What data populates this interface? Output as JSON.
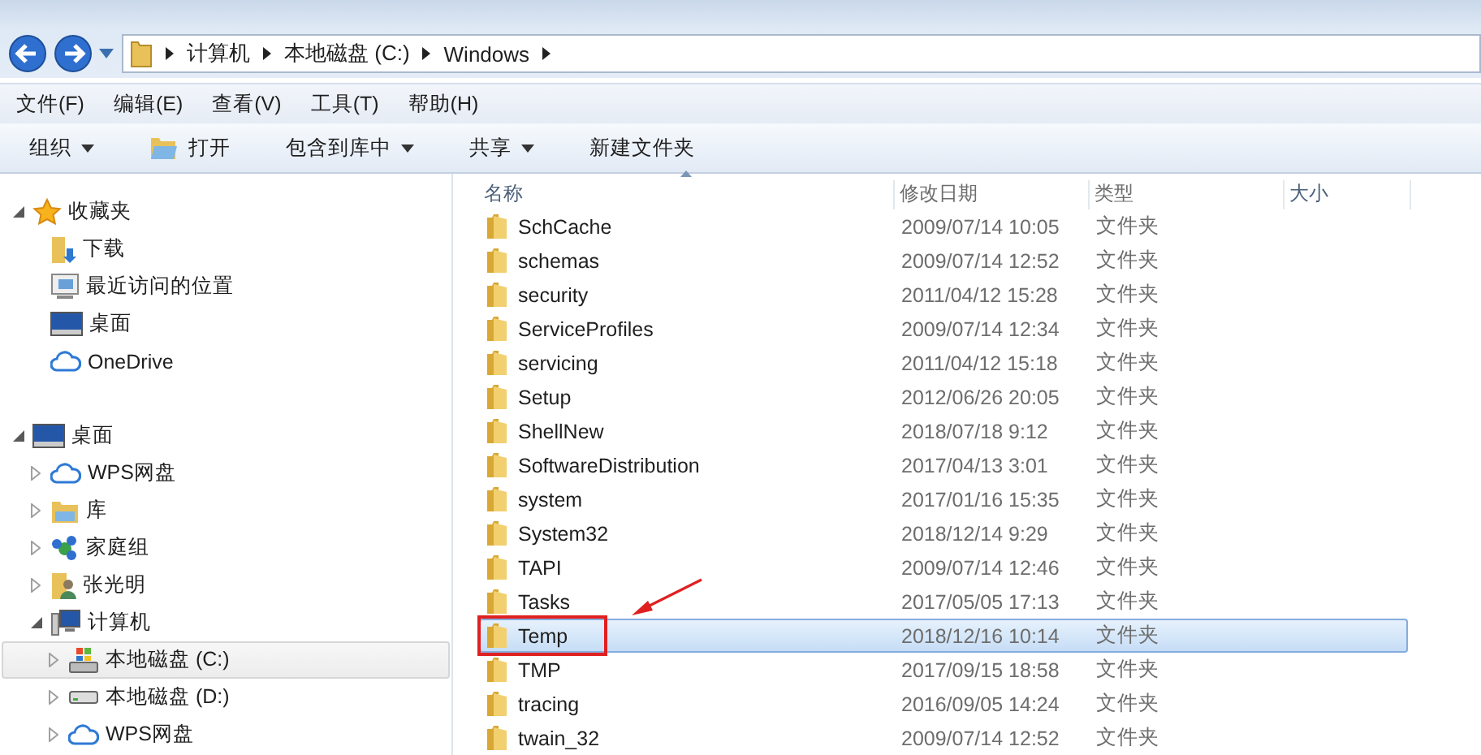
{
  "address_bar": {
    "crumbs": [
      "计算机",
      "本地磁盘 (C:)",
      "Windows"
    ]
  },
  "menu_bar": [
    "文件(F)",
    "编辑(E)",
    "查看(V)",
    "工具(T)",
    "帮助(H)"
  ],
  "toolbar": [
    {
      "label": "组织",
      "dropdown": true
    },
    {
      "label": "打开",
      "dropdown": false
    },
    {
      "label": "包含到库中",
      "dropdown": true
    },
    {
      "label": "共享",
      "dropdown": true
    },
    {
      "label": "新建文件夹",
      "dropdown": false
    }
  ],
  "nav_tree": [
    {
      "label": "收藏夹",
      "expanded": true,
      "selected": false,
      "children": [
        {
          "label": "下载",
          "selected": false
        },
        {
          "label": "最近访问的位置",
          "selected": false
        },
        {
          "label": "桌面",
          "selected": false
        },
        {
          "label": "OneDrive",
          "selected": false
        }
      ]
    },
    {
      "label": "桌面",
      "expanded": true,
      "selected": false,
      "children": [
        {
          "label": "WPS网盘",
          "expanded": false,
          "selected": false
        },
        {
          "label": "库",
          "expanded": false,
          "selected": false
        },
        {
          "label": "家庭组",
          "expanded": false,
          "selected": false
        },
        {
          "label": "张光明",
          "expanded": false,
          "selected": false
        },
        {
          "label": "计算机",
          "expanded": true,
          "selected": false,
          "children": [
            {
              "label": "本地磁盘 (C:)",
              "expanded": false,
              "selected": true
            },
            {
              "label": "本地磁盘 (D:)",
              "expanded": false,
              "selected": false
            },
            {
              "label": "WPS网盘",
              "expanded": false,
              "selected": false
            }
          ]
        }
      ]
    }
  ],
  "file_list": {
    "columns": [
      {
        "label": "名称",
        "sorted": true
      },
      {
        "label": "修改日期",
        "sorted": false
      },
      {
        "label": "类型",
        "sorted": false
      },
      {
        "label": "大小",
        "sorted": false
      }
    ],
    "rows": [
      {
        "name": "SchCache",
        "modified": "2009/07/14 10:05",
        "type": "文件夹",
        "selected": false,
        "callout": false
      },
      {
        "name": "schemas",
        "modified": "2009/07/14 12:52",
        "type": "文件夹",
        "selected": false,
        "callout": false
      },
      {
        "name": "security",
        "modified": "2011/04/12 15:28",
        "type": "文件夹",
        "selected": false,
        "callout": false
      },
      {
        "name": "ServiceProfiles",
        "modified": "2009/07/14 12:34",
        "type": "文件夹",
        "selected": false,
        "callout": false
      },
      {
        "name": "servicing",
        "modified": "2011/04/12 15:18",
        "type": "文件夹",
        "selected": false,
        "callout": false
      },
      {
        "name": "Setup",
        "modified": "2012/06/26 20:05",
        "type": "文件夹",
        "selected": false,
        "callout": false
      },
      {
        "name": "ShellNew",
        "modified": "2018/07/18 9:12",
        "type": "文件夹",
        "selected": false,
        "callout": false
      },
      {
        "name": "SoftwareDistribution",
        "modified": "2017/04/13 3:01",
        "type": "文件夹",
        "selected": false,
        "callout": false
      },
      {
        "name": "system",
        "modified": "2017/01/16 15:35",
        "type": "文件夹",
        "selected": false,
        "callout": false
      },
      {
        "name": "System32",
        "modified": "2018/12/14 9:29",
        "type": "文件夹",
        "selected": false,
        "callout": false
      },
      {
        "name": "TAPI",
        "modified": "2009/07/14 12:46",
        "type": "文件夹",
        "selected": false,
        "callout": false
      },
      {
        "name": "Tasks",
        "modified": "2017/05/05 17:13",
        "type": "文件夹",
        "selected": false,
        "callout": false
      },
      {
        "name": "Temp",
        "modified": "2018/12/16 10:14",
        "type": "文件夹",
        "selected": true,
        "callout": true
      },
      {
        "name": "TMP",
        "modified": "2017/09/15 18:58",
        "type": "文件夹",
        "selected": false,
        "callout": false
      },
      {
        "name": "tracing",
        "modified": "2016/09/05 14:24",
        "type": "文件夹",
        "selected": false,
        "callout": false
      },
      {
        "name": "twain_32",
        "modified": "2009/07/14 12:52",
        "type": "文件夹",
        "selected": false,
        "callout": false
      }
    ]
  }
}
